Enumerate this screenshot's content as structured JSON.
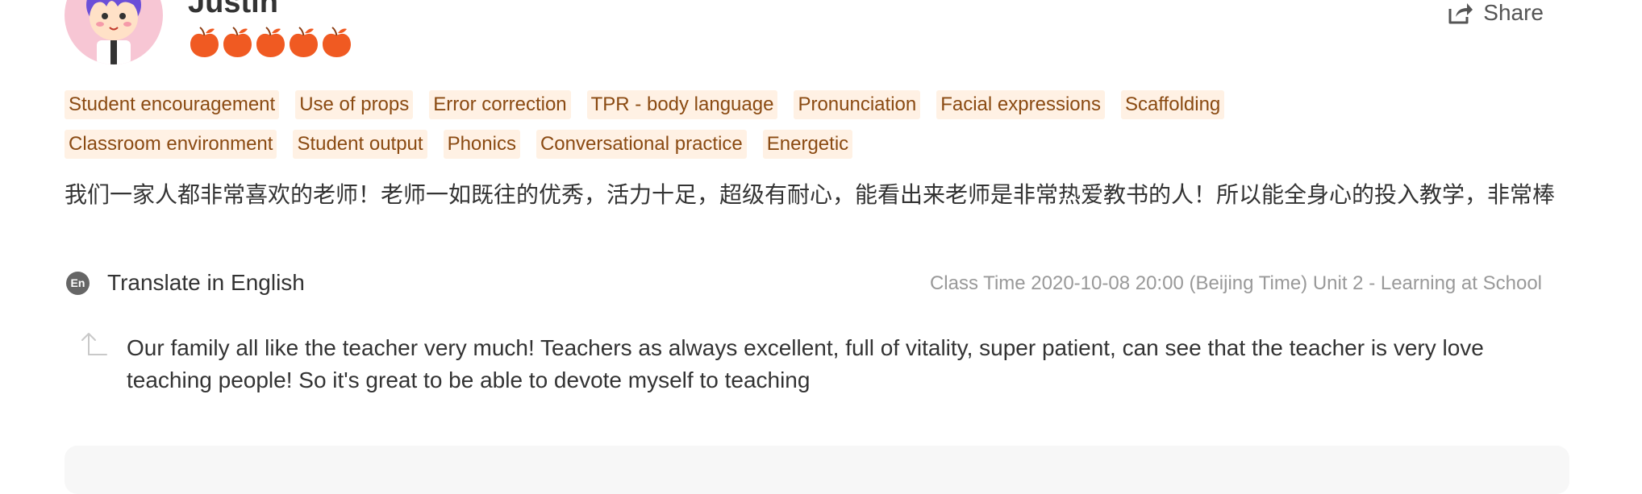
{
  "review": {
    "username": "Justin",
    "rating": 5,
    "rating_icon": "apple-icon",
    "share_label": "Share",
    "tags": [
      "Student encouragement",
      "Use of props",
      "Error correction",
      "TPR - body language",
      "Pronunciation",
      "Facial expressions",
      "Scaffolding",
      "Classroom environment",
      "Student output",
      "Phonics",
      "Conversational practice",
      "Energetic"
    ],
    "text_original": "我们一家人都非常喜欢的老师！老师一如既往的优秀，活力十足，超级有耐心，能看出来老师是非常热爱教书的人！所以能全身心的投入教学，非常棒",
    "translate_badge": "En",
    "translate_label": "Translate in English",
    "class_info": "Class Time 2020-10-08 20:00 (Beijing Time) Unit 2 - Learning at School",
    "text_translated": "Our family all like the teacher very much! Teachers as always excellent, full of vitality, super patient, can see that the teacher is very love teaching people! So it's great to be able to devote myself to teaching"
  },
  "colors": {
    "tag_bg": "#fff1e4",
    "tag_text": "#8a4a12",
    "rating": "#f05a22",
    "avatar_bg": "#f7c6d4"
  }
}
